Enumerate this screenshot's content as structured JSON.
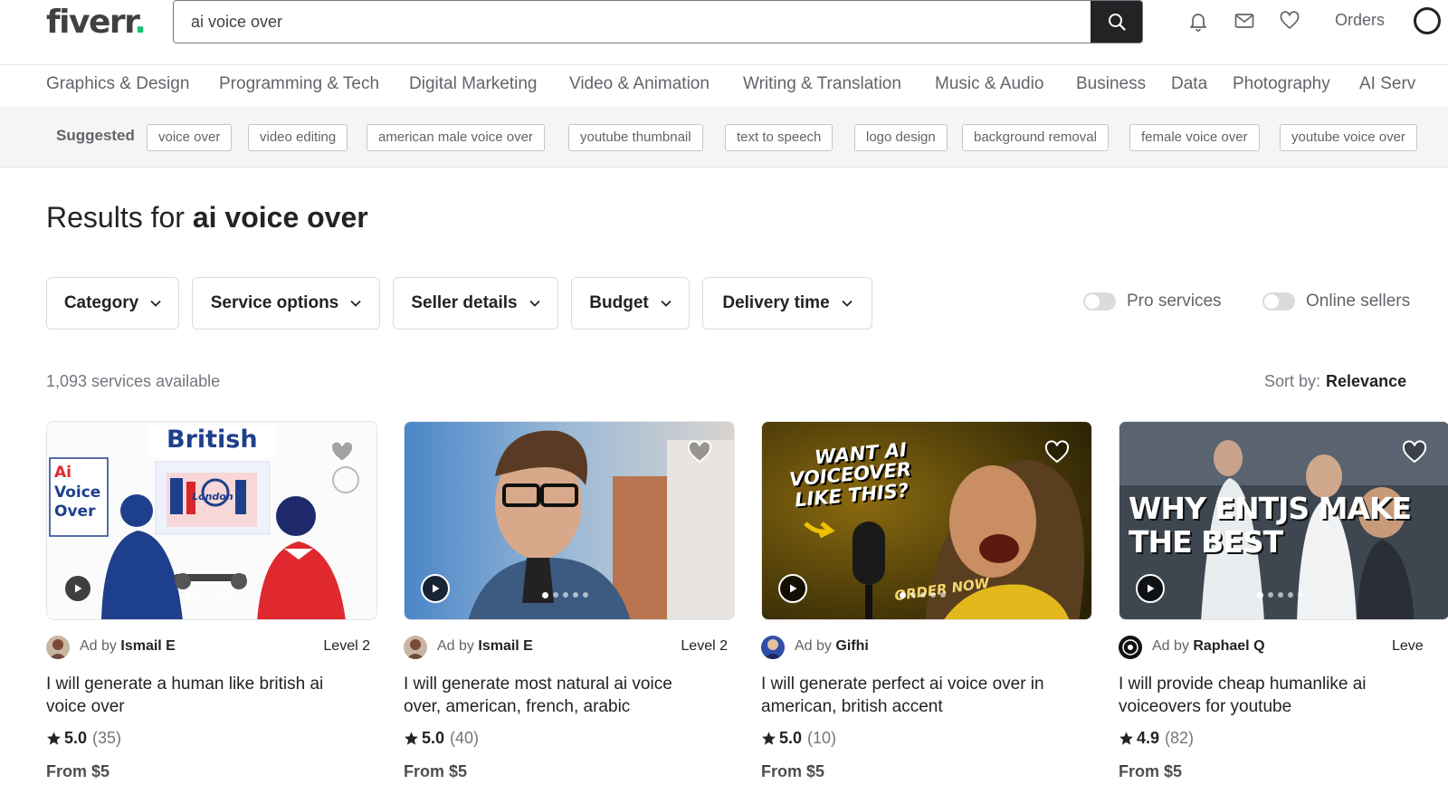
{
  "header": {
    "logo": "fiverr",
    "logo_dot": ".",
    "search_value": "ai voice over",
    "orders_label": "Orders"
  },
  "categories": [
    "Graphics & Design",
    "Programming & Tech",
    "Digital Marketing",
    "Video & Animation",
    "Writing & Translation",
    "Music & Audio",
    "Business",
    "Data",
    "Photography",
    "AI Serv"
  ],
  "suggested": {
    "label": "Suggested",
    "chips": [
      "voice over",
      "video editing",
      "american male voice over",
      "youtube thumbnail",
      "text to speech",
      "logo design",
      "background removal",
      "female voice over",
      "youtube voice over"
    ]
  },
  "results": {
    "prefix": "Results for",
    "query": "ai voice over"
  },
  "filters": [
    "Category",
    "Service options",
    "Seller details",
    "Budget",
    "Delivery time"
  ],
  "toggles": [
    "Pro services",
    "Online sellers"
  ],
  "count_text": "1,093 services available",
  "sort": {
    "label": "Sort by:",
    "value": "Relevance"
  },
  "gigs": [
    {
      "ad_prefix": "Ad by",
      "seller": "Ismail E",
      "level": "Level 2",
      "title": "I will generate a human like british ai voice over",
      "rating": "5.0",
      "reviews": "(35)",
      "price": "From $5",
      "image_text": {
        "british": "British",
        "ai": "Ai",
        "voice": "Voice",
        "over": "Over",
        "london": "London"
      }
    },
    {
      "ad_prefix": "Ad by",
      "seller": "Ismail E",
      "level": "Level 2",
      "title": "I will generate most natural ai voice over, american, french, arabic",
      "rating": "5.0",
      "reviews": "(40)",
      "price": "From $5"
    },
    {
      "ad_prefix": "Ad by",
      "seller": "Gifhi",
      "level": "",
      "title": "I will generate perfect ai voice over in american, british accent",
      "rating": "5.0",
      "reviews": "(10)",
      "price": "From $5",
      "image_text": {
        "line1": "WANT AI",
        "line2": "VOICEOVER",
        "line3": "LIKE THIS?",
        "cta": "ORDER NOW"
      }
    },
    {
      "ad_prefix": "Ad by",
      "seller": "Raphael Q",
      "level": "Leve",
      "title": "I will provide cheap humanlike ai voiceovers for youtube",
      "rating": "4.9",
      "reviews": "(82)",
      "price": "From $5",
      "image_text": {
        "line1": "WHY ENTJS MAKE",
        "line2": "THE BEST"
      }
    }
  ],
  "colors": {
    "brand_green": "#1dbf73",
    "text_dark": "#222325",
    "text_muted": "#62646a"
  }
}
